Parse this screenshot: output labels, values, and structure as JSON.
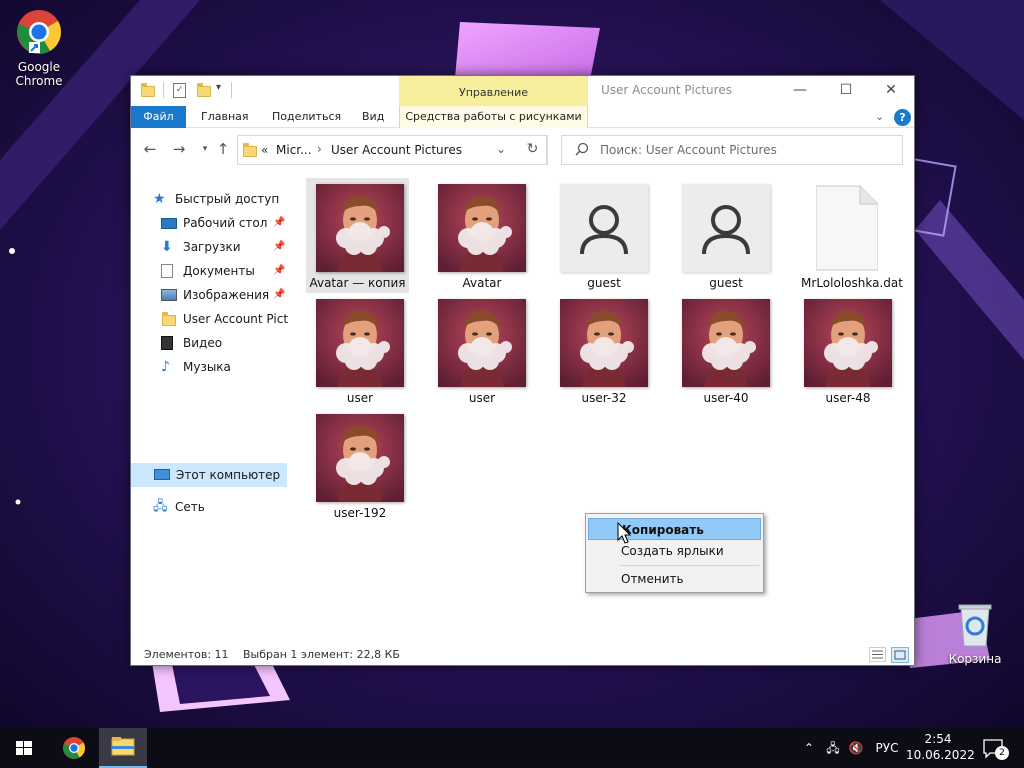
{
  "desktop": {
    "icons": [
      {
        "label": "Google Chrome"
      },
      {
        "label": "Корзина"
      }
    ]
  },
  "window": {
    "title": "User Account Pictures",
    "manage_tab": "Управление",
    "ribbon_tabs": [
      "Файл",
      "Главная",
      "Поделиться",
      "Вид",
      "Средства работы с рисунками"
    ],
    "controls": {
      "minimize": "—",
      "maximize": "☐",
      "close": "✕",
      "help": "?",
      "collapse": "⌄"
    }
  },
  "navbar": {
    "breadcrumb": [
      "«",
      "Micr...",
      "User Account Pictures"
    ],
    "search_placeholder": "Поиск: User Account Pictures"
  },
  "sidebar": {
    "items": [
      {
        "label": "Быстрый доступ",
        "icon": "star-icon",
        "pinned": false
      },
      {
        "label": "Рабочий стол",
        "icon": "desktop-icon",
        "pinned": true
      },
      {
        "label": "Загрузки",
        "icon": "download-icon",
        "pinned": true
      },
      {
        "label": "Документы",
        "icon": "documents-icon",
        "pinned": true
      },
      {
        "label": "Изображения",
        "icon": "pictures-icon",
        "pinned": true
      },
      {
        "label": "User Account Pictur",
        "icon": "folder-icon",
        "pinned": false
      },
      {
        "label": "Видео",
        "icon": "video-icon",
        "pinned": false
      },
      {
        "label": "Музыка",
        "icon": "music-icon",
        "pinned": false
      },
      {
        "label": "Этот компьютер",
        "icon": "computer-icon",
        "pinned": false
      },
      {
        "label": "Сеть",
        "icon": "network-icon",
        "pinned": false
      }
    ]
  },
  "files": [
    {
      "name": "Avatar — копия",
      "kind": "avatar",
      "selected": true
    },
    {
      "name": "Avatar",
      "kind": "avatar",
      "selected": false
    },
    {
      "name": "guest",
      "kind": "guest",
      "selected": false
    },
    {
      "name": "guest",
      "kind": "guest",
      "selected": false
    },
    {
      "name": "MrLololoshka.dat",
      "kind": "file",
      "selected": false
    },
    {
      "name": "user",
      "kind": "avatar",
      "selected": false
    },
    {
      "name": "user",
      "kind": "avatar",
      "selected": false
    },
    {
      "name": "user-32",
      "kind": "avatar",
      "selected": false
    },
    {
      "name": "user-40",
      "kind": "avatar",
      "selected": false
    },
    {
      "name": "user-48",
      "kind": "avatar",
      "selected": false
    },
    {
      "name": "user-192",
      "kind": "avatar",
      "selected": false
    }
  ],
  "statusbar": {
    "count": "Элементов: 11",
    "selection": "Выбран 1 элемент: 22,8 КБ"
  },
  "context_menu": {
    "items": [
      "Копировать",
      "Создать ярлыки",
      "Отменить"
    ]
  },
  "taskbar": {
    "language": "РУС",
    "time": "2:54",
    "date": "10.06.2022",
    "notifications": "2"
  },
  "colors": {
    "accent": "#1979ca",
    "manage_tab": "#f6ee9a",
    "selection": "#e5e5e5",
    "menu_highlight": "#91c9f7"
  }
}
